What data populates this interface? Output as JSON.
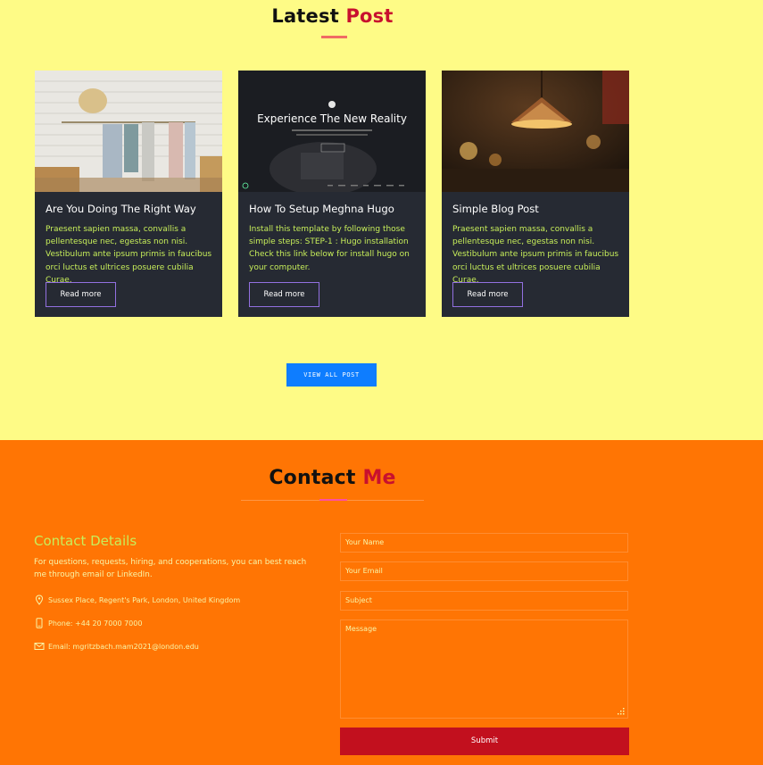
{
  "latest": {
    "title_main": "Latest",
    "title_accent": "Post",
    "posts": [
      {
        "title": "Are You Doing The Right Way",
        "excerpt": "Praesent sapien massa, convallis a pellentesque nec, egestas non nisi. Vestibulum ante ipsum primis in faucibus orci luctus et ultrices posuere cubilia Curae.",
        "button": "Read more"
      },
      {
        "title": "How To Setup Meghna Hugo",
        "excerpt": "Install this template by following those simple steps: STEP-1 : Hugo installation Check this link below for install hugo on your computer.",
        "button": "Read more",
        "image_heading": "Experience The New Reality"
      },
      {
        "title": "Simple Blog Post",
        "excerpt": "Praesent sapien massa, convallis a pellentesque nec, egestas non nisi. Vestibulum ante ipsum primis in faucibus orci luctus et ultrices posuere cubilia Curae.",
        "button": "Read more"
      }
    ],
    "view_all": "VIEW ALL POST"
  },
  "contact": {
    "title_main": "Contact",
    "title_accent": "Me",
    "details_heading": "Contact Details",
    "details_text": "For questions, requests, hiring, and cooperations, you can best reach me through email or LinkedIn.",
    "address": "Sussex Place, Regent's Park, London, United Kingdom",
    "phone": "Phone: +44 20 7000 7000",
    "email": "Email: mgritzbach.mam2021@london.edu",
    "form": {
      "name_placeholder": "Your Name",
      "email_placeholder": "Your Email",
      "subject_placeholder": "Subject",
      "message_placeholder": "Message",
      "submit": "Submit"
    }
  },
  "colors": {
    "latest_bg": "#fefb86",
    "contact_bg": "#ff7504",
    "accent_red": "#c8102e",
    "card_bg": "#262a33",
    "card_text": "#c7ee5a",
    "view_all_bg": "#0e7dff",
    "submit_bg": "#c2101e"
  }
}
